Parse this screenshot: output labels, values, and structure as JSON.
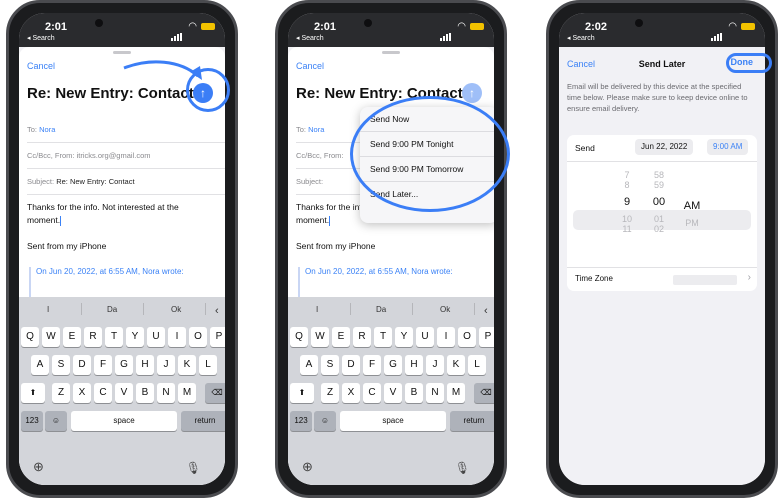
{
  "status": {
    "time_1": "2:01",
    "time_2": "2:01",
    "time_3": "2:02",
    "back_label": "◂ Search"
  },
  "colors": {
    "accent": "#3b82f6",
    "ring": "#3b7ef6"
  },
  "compose": {
    "cancel": "Cancel",
    "subject_title": "Re: New Entry: Contact",
    "to_label": "To:",
    "to_value": "Nora",
    "ccbcc_label": "Cc/Bcc, From:",
    "from_value": "itricks.org@gmail.com",
    "subject_label": "Subject:",
    "subject_value": "Re: New Entry: Contact",
    "body_line1": "Thanks for the info. Not interested at the",
    "body_line2": "moment.",
    "signature": "Sent from my iPhone",
    "quote": "On Jun 20, 2022, at 6:55 AM, Nora wrote:"
  },
  "keyboard": {
    "suggestions": [
      "I",
      "Da",
      "Ok"
    ],
    "row1": [
      "Q",
      "W",
      "E",
      "R",
      "T",
      "Y",
      "U",
      "I",
      "O",
      "P"
    ],
    "row2": [
      "A",
      "S",
      "D",
      "F",
      "G",
      "H",
      "J",
      "K",
      "L"
    ],
    "row3": [
      "Z",
      "X",
      "C",
      "V",
      "B",
      "N",
      "M"
    ],
    "numbers": "123",
    "space": "space",
    "return": "return"
  },
  "send_menu": [
    "Send Now",
    "Send 9:00 PM Tonight",
    "Send 9:00 PM Tomorrow",
    "Send Later..."
  ],
  "send_later": {
    "cancel": "Cancel",
    "title": "Send Later",
    "done": "Done",
    "description": "Email will be delivered by this device at the specified time below. Please make sure to keep device online to ensure email delivery.",
    "send_label": "Send",
    "date": "Jun 22, 2022",
    "time": "9:00 AM",
    "hours": [
      "7",
      "8",
      "9",
      "10",
      "11"
    ],
    "minutes": [
      "58",
      "59",
      "00",
      "01",
      "02"
    ],
    "meridiem": [
      "AM",
      "PM"
    ],
    "timezone_label": "Time Zone"
  }
}
